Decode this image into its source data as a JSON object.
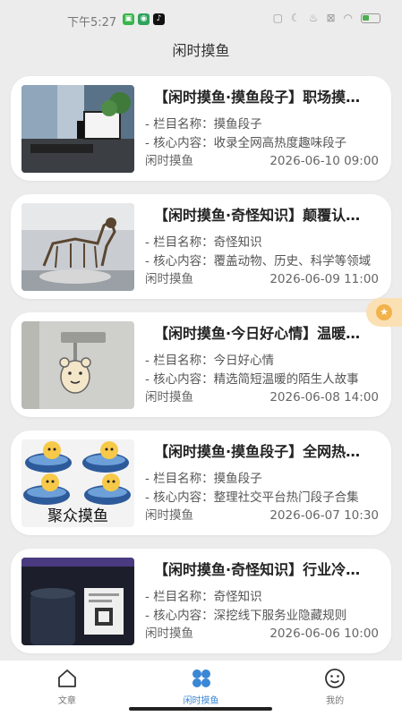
{
  "status": {
    "time": "下午5:27",
    "apps": [
      {
        "icon": "chat-app-icon",
        "color": "#39b54a",
        "glyph": "▣"
      },
      {
        "icon": "shield-app-icon",
        "color": "#2fa35e",
        "glyph": "◉"
      },
      {
        "icon": "tiktok-app-icon",
        "color": "#111111",
        "glyph": "♪"
      }
    ],
    "right_icons": [
      "sim-icon",
      "moon-icon",
      "mute-icon",
      "nosim-icon",
      "wifi-icon",
      "battery-icon"
    ]
  },
  "header": {
    "title": "闲时摸鱼"
  },
  "cards": [
    {
      "title": "【闲时摸鱼·摸鱼段子】职场摸鱼段子",
      "meta1": {
        "prefix": "- ",
        "label": "栏目名称",
        "sep": "：",
        "value": "摸鱼段子"
      },
      "meta2": {
        "prefix": "- ",
        "label": "核心内容",
        "sep": "：",
        "value": "收录全网高热度趣味段子"
      },
      "source": "闲时摸鱼",
      "date": "2026-06-10 09:00",
      "thumb": "office-desk"
    },
    {
      "title": "【闲时摸鱼·奇怪知识】颠覆认知的冷知识",
      "meta1": {
        "prefix": "- ",
        "label": "栏目名称",
        "sep": "：",
        "value": "奇怪知识"
      },
      "meta2": {
        "prefix": "- ",
        "label": "核心内容",
        "sep": "：",
        "value": "覆盖动物、历史、科学等领域"
      },
      "source": "闲时摸鱼",
      "date": "2026-06-09 11:00",
      "thumb": "skeleton"
    },
    {
      "title": "【闲时摸鱼·今日好心情】温暖小事",
      "meta1": {
        "prefix": "- ",
        "label": "栏目名称",
        "sep": "：",
        "value": "今日好心情"
      },
      "meta2": {
        "prefix": "- ",
        "label": "核心内容",
        "sep": "：",
        "value": "精选简短温暖的陌生人故事"
      },
      "source": "闲时摸鱼",
      "date": "2026-06-08 14:00",
      "thumb": "bear-sticker"
    },
    {
      "title": "【闲时摸鱼·摸鱼段子】全网热门段子",
      "meta1": {
        "prefix": "- ",
        "label": "栏目名称",
        "sep": "：",
        "value": "摸鱼段子"
      },
      "meta2": {
        "prefix": "- ",
        "label": "核心内容",
        "sep": "：",
        "value": "整理社交平台热门段子合集"
      },
      "source": "闲时摸鱼",
      "date": "2026-06-07 10:30",
      "thumb": "fish-meme",
      "thumb_caption": "聚众摸鱼"
    },
    {
      "title": "【闲时摸鱼·奇怪知识】行业冷知识",
      "meta1": {
        "prefix": "- ",
        "label": "栏目名称",
        "sep": "：",
        "value": "奇怪知识"
      },
      "meta2": {
        "prefix": "- ",
        "label": "核心内容",
        "sep": "：",
        "value": "深挖线下服务业隐藏规则"
      },
      "source": "闲时摸鱼",
      "date": "2026-06-06 10:00",
      "thumb": "receipt"
    }
  ],
  "tabs": [
    {
      "label": "文章",
      "icon": "house-icon",
      "active": false
    },
    {
      "label": "闲时摸鱼",
      "icon": "clover-icon",
      "active": true
    },
    {
      "label": "我的",
      "icon": "smiley-icon",
      "active": false
    }
  ],
  "colors": {
    "accent": "#3a87d6",
    "card_bg": "#ffffff",
    "page_bg": "#ececec"
  }
}
